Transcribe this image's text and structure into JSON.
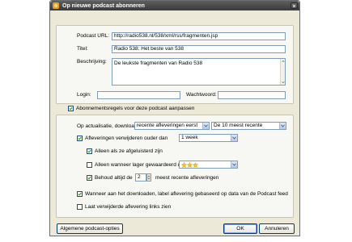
{
  "window": {
    "title": "Op nieuwe podcast abonneren",
    "accent": "#e8a11c"
  },
  "podcast": {
    "url_label": "Podcast URL:",
    "url_value": "http://radio538.nl/538/xml/rss/fragmenten.jsp",
    "title_label": "Titel:",
    "title_value": "Radio 538: Het beste van 538",
    "description_label": "Beschrijving:",
    "description_value": "De leukste fragmenten van Radio 538",
    "login_label": "Login:",
    "login_value": "",
    "password_label": "Wachtwoord:",
    "password_value": ""
  },
  "custom_rules": {
    "label": "Abonnementsregels voor deze podcast aanpassen",
    "checked": true
  },
  "rules": {
    "update_label": "Op actualisatie, download",
    "update_select": "recente afleveringen eerst",
    "count_select": "De 10 meest recente",
    "delete_older_label": "Afleveringen verwijderen ouder dan",
    "delete_older_checked": true,
    "delete_older_select": "1 week",
    "only_listened_label": "Alleen als ze afgeluisterd zijn",
    "only_listened_checked": true,
    "only_lower_rated_label": "Alleen wanneer lager gewaardeerd dan",
    "only_lower_rated_checked": false,
    "rating_stars": 3,
    "keep_label": "Behoud altijd de",
    "keep_checked": true,
    "keep_value": "2",
    "keep_suffix": "meest recente afleveringen",
    "label_download": "Wanneer aan het downloaden, label aflevering gebaseerd op data van de Podcast feed",
    "label_download_checked": true,
    "show_deleted": "Laat verwijderde aflevering links zien",
    "show_deleted_checked": false
  },
  "buttons": {
    "general_options": "Algemene podcast-opties",
    "ok": "OK",
    "cancel": "Annuleren"
  }
}
